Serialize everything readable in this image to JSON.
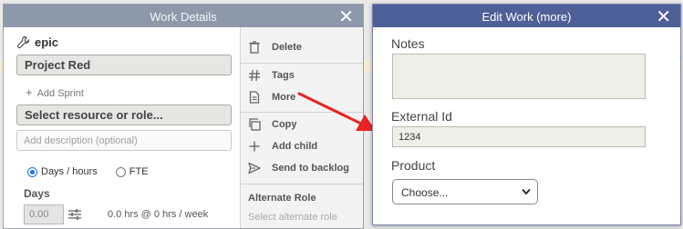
{
  "work_details": {
    "title": "Work Details",
    "item_type": "epic",
    "name": "Project Red",
    "add_sprint": "Add Sprint",
    "resource": "Select resource or role...",
    "description_placeholder": "Add description (optional)",
    "mode_days": "Days / hours",
    "mode_fte": "FTE",
    "days_label": "Days",
    "days_value": "0.00",
    "hours_summary": "0.0 hrs @ 0 hrs / week",
    "menu": {
      "delete": "Delete",
      "tags": "Tags",
      "more": "More",
      "copy": "Copy",
      "add_child": "Add child",
      "send_to_backlog": "Send to backlog"
    },
    "alternate_role_label": "Alternate Role",
    "alternate_role_placeholder": "Select alternate role"
  },
  "edit_work": {
    "title": "Edit Work (more)",
    "notes_label": "Notes",
    "notes_value": "",
    "external_id_label": "External Id",
    "external_id_value": "1234",
    "product_label": "Product",
    "product_selected": "Choose..."
  },
  "colors": {
    "work_details_titlebar": "#8d98aa",
    "edit_work_titlebar": "#4f5f98",
    "arrow": "#e8231f",
    "radio_accent": "#1a73e8"
  }
}
